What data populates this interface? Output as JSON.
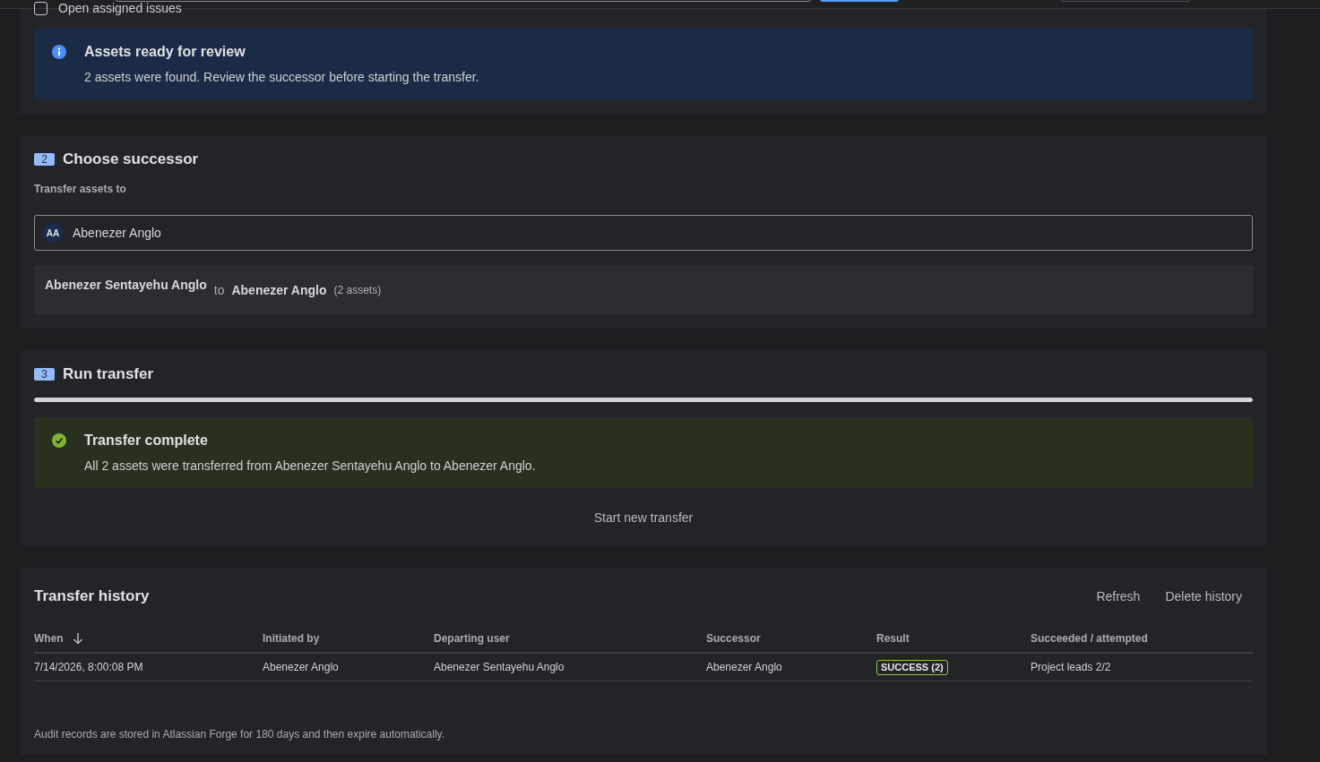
{
  "top_bar": {
    "filter": {
      "label": "Open assigned issues",
      "checked": false
    }
  },
  "review_banner": {
    "kind": "info",
    "title": "Assets ready for review",
    "message": "2 assets were found. Review the successor before starting the transfer."
  },
  "choose_successor": {
    "step": "2",
    "title": "Choose successor",
    "field_label": "Transfer assets to",
    "selected_user": {
      "initials": "AA",
      "name": "Abenezer Anglo"
    },
    "summary": {
      "from": "Abenezer Sentayehu Anglo",
      "joiner": "to",
      "to": "Abenezer Anglo",
      "count": "(2 assets)"
    }
  },
  "run_transfer": {
    "step": "3",
    "title": "Run transfer",
    "progress": {
      "level": 1
    },
    "banner": {
      "kind": "success",
      "title": "Transfer complete",
      "message": "All 2 assets were transferred from Abenezer Sentayehu Anglo to Abenezer Anglo."
    },
    "action": "Start new transfer"
  },
  "transfer_history": {
    "title": "Transfer history",
    "actions": [
      "Refresh",
      "Delete history"
    ],
    "table": {
      "columns": [
        {
          "label": "When",
          "sorted": true
        },
        {
          "label": "Initiated by",
          "sorted": false
        },
        {
          "label": "Departing user",
          "sorted": false
        },
        {
          "label": "Successor",
          "sorted": false
        },
        {
          "label": "Result",
          "sorted": false
        },
        {
          "label": "Succeeded / attempted",
          "sorted": false
        }
      ],
      "rows": [
        {
          "cells": [
            {
              "kind": "text",
              "text": "7/14/2026, 8:00:08 PM"
            },
            {
              "kind": "text",
              "text": "Abenezer Anglo"
            },
            {
              "kind": "text",
              "text": "Abenezer Sentayehu Anglo"
            },
            {
              "kind": "text",
              "text": "Abenezer Anglo"
            },
            {
              "kind": "badge",
              "text": "SUCCESS (2)"
            },
            {
              "kind": "text",
              "text": "Project leads 2/2"
            }
          ]
        }
      ]
    },
    "footer": "Audit records are stored in Atlassian Forge for 180 days and then expire automatically."
  }
}
